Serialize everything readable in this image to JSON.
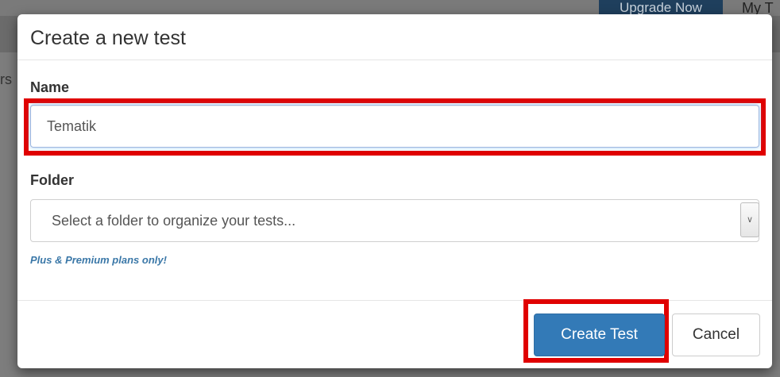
{
  "background": {
    "upgrade_label": "Upgrade Now",
    "mytests_label": "My T",
    "fragment_text": "rs"
  },
  "modal": {
    "title": "Create a new test",
    "name_label": "Name",
    "name_value": "Tematik",
    "folder_label": "Folder",
    "folder_placeholder": "Select a folder to organize your tests...",
    "folder_icon": "chevron-down-icon",
    "plan_note": "Plus & Premium plans only!",
    "create_button": "Create Test",
    "cancel_button": "Cancel"
  },
  "colors": {
    "highlight": "#e00000",
    "primary": "#337ab7",
    "note": "#3b78a8"
  }
}
